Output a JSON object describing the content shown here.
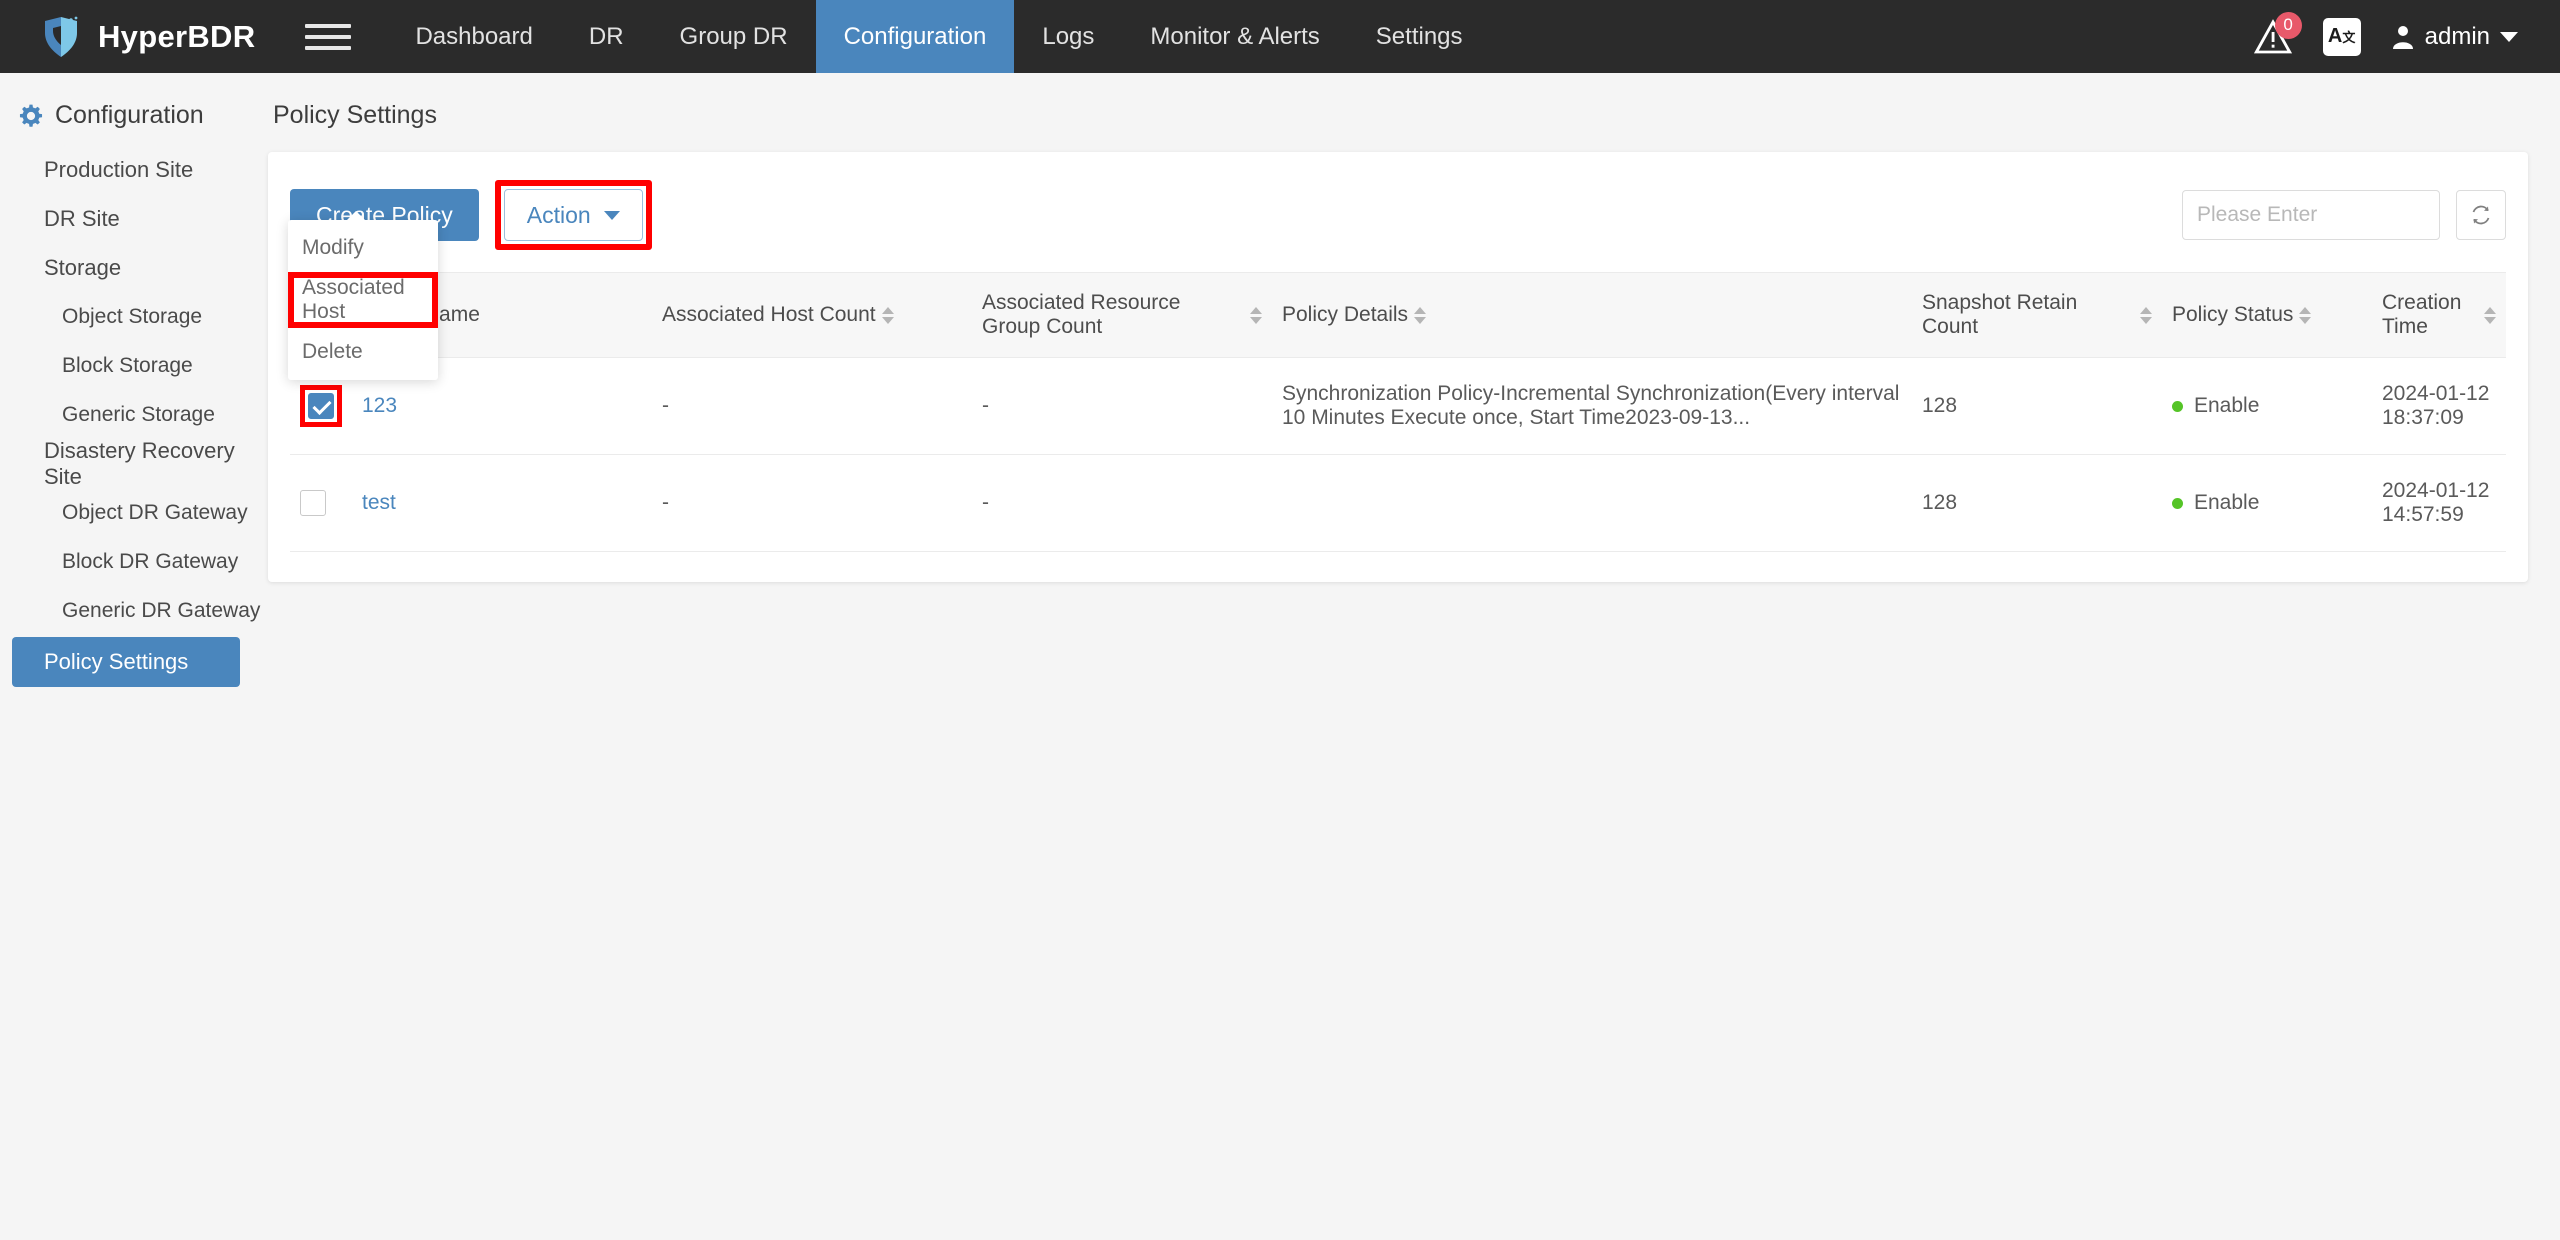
{
  "header": {
    "brand": "HyperBDR",
    "menu_icon": "hamburger-icon",
    "nav": [
      {
        "label": "Dashboard",
        "active": false
      },
      {
        "label": "DR",
        "active": false
      },
      {
        "label": "Group DR",
        "active": false
      },
      {
        "label": "Configuration",
        "active": true
      },
      {
        "label": "Logs",
        "active": false
      },
      {
        "label": "Monitor & Alerts",
        "active": false
      },
      {
        "label": "Settings",
        "active": false
      }
    ],
    "alert_badge": "0",
    "translate_label": "A",
    "user": "admin"
  },
  "sidebar": {
    "title": "Configuration",
    "items": [
      {
        "label": "Production Site",
        "level": 1,
        "active": false
      },
      {
        "label": "DR Site",
        "level": 1,
        "active": false
      },
      {
        "label": "Storage",
        "level": 1,
        "active": false
      },
      {
        "label": "Object Storage",
        "level": 2,
        "active": false
      },
      {
        "label": "Block Storage",
        "level": 2,
        "active": false
      },
      {
        "label": "Generic Storage",
        "level": 2,
        "active": false
      },
      {
        "label": "Disastery Recovery Site",
        "level": 1,
        "active": false
      },
      {
        "label": "Object DR Gateway",
        "level": 2,
        "active": false
      },
      {
        "label": "Block DR Gateway",
        "level": 2,
        "active": false
      },
      {
        "label": "Generic DR Gateway",
        "level": 2,
        "active": false
      },
      {
        "label": "Policy Settings",
        "level": 1,
        "active": true
      }
    ]
  },
  "page": {
    "title": "Policy Settings"
  },
  "toolbar": {
    "create_label": "Create Policy",
    "action_label": "Action",
    "search_placeholder": "Please Enter",
    "search_value": "",
    "refresh_label": "refresh-icon"
  },
  "dropdown": {
    "open": true,
    "items": [
      {
        "label": "Modify",
        "highlighted": false
      },
      {
        "label": "Associated Host",
        "highlighted": true
      },
      {
        "label": "Delete",
        "highlighted": false
      }
    ]
  },
  "table": {
    "select_all_state": "indeterminate",
    "columns": [
      {
        "label": "Policy Name",
        "sortable": false
      },
      {
        "label": "Associated Host Count",
        "sortable": true
      },
      {
        "label": "Associated Resource Group Count",
        "sortable": true
      },
      {
        "label": "Policy Details",
        "sortable": true
      },
      {
        "label": "Snapshot Retain Count",
        "sortable": true
      },
      {
        "label": "Policy Status",
        "sortable": true
      },
      {
        "label": "Creation Time",
        "sortable": true
      }
    ],
    "rows": [
      {
        "checked": true,
        "checkbox_highlighted": true,
        "name": "123",
        "host_count": "-",
        "resource_group_count": "-",
        "details": "Synchronization Policy-Incremental Synchronization(Every interval 10 Minutes Execute once, Start Time2023-09-13...",
        "snapshot_retain_count": "128",
        "status": "Enable",
        "creation_time": "2024-01-12 18:37:09"
      },
      {
        "checked": false,
        "checkbox_highlighted": false,
        "name": "test",
        "host_count": "-",
        "resource_group_count": "-",
        "details": "",
        "snapshot_retain_count": "128",
        "status": "Enable",
        "creation_time": "2024-01-12 14:57:59"
      }
    ]
  },
  "colors": {
    "accent": "#4a86bd",
    "topbar": "#2b2b2b",
    "status_enable": "#55c427",
    "highlight": "#ff0000",
    "badge": "#e8596a"
  }
}
